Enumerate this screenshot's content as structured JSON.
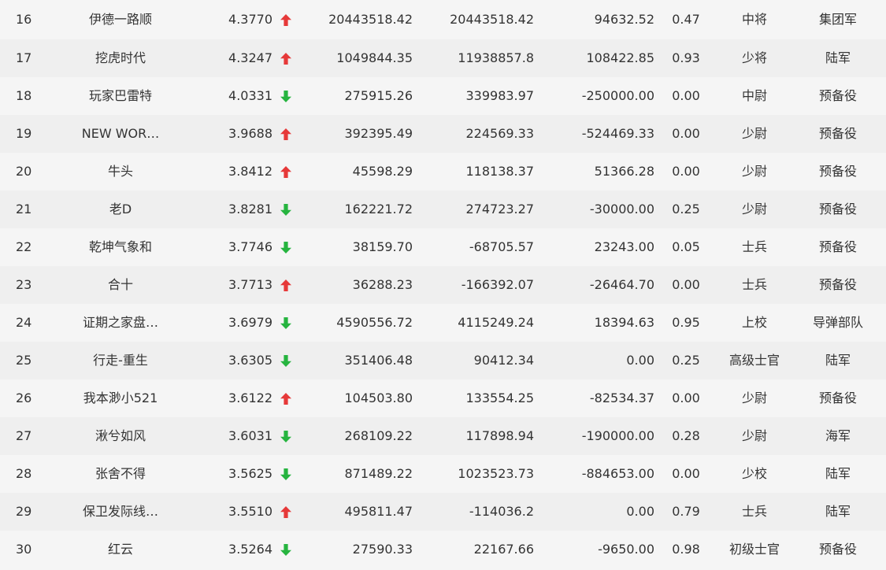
{
  "rows": [
    {
      "rank": "16",
      "name": "伊德一路顺",
      "score": "4.3770",
      "trend": "up",
      "value1": "20443518.42",
      "value2": "20443518.42",
      "value3": "94632.52",
      "ratio": "0.47",
      "military_rank": "中将",
      "branch": "集团军"
    },
    {
      "rank": "17",
      "name": "挖虎时代",
      "score": "4.3247",
      "trend": "up",
      "value1": "1049844.35",
      "value2": "11938857.8",
      "value3": "108422.85",
      "ratio": "0.93",
      "military_rank": "少将",
      "branch": "陆军"
    },
    {
      "rank": "18",
      "name": "玩家巴雷特",
      "score": "4.0331",
      "trend": "down",
      "value1": "275915.26",
      "value2": "339983.97",
      "value3": "-250000.00",
      "ratio": "0.00",
      "military_rank": "中尉",
      "branch": "预备役"
    },
    {
      "rank": "19",
      "name": "NEW WOR…",
      "score": "3.9688",
      "trend": "up",
      "value1": "392395.49",
      "value2": "224569.33",
      "value3": "-524469.33",
      "ratio": "0.00",
      "military_rank": "少尉",
      "branch": "预备役"
    },
    {
      "rank": "20",
      "name": "牛头",
      "score": "3.8412",
      "trend": "up",
      "value1": "45598.29",
      "value2": "118138.37",
      "value3": "51366.28",
      "ratio": "0.00",
      "military_rank": "少尉",
      "branch": "预备役"
    },
    {
      "rank": "21",
      "name": "老D",
      "score": "3.8281",
      "trend": "down",
      "value1": "162221.72",
      "value2": "274723.27",
      "value3": "-30000.00",
      "ratio": "0.25",
      "military_rank": "少尉",
      "branch": "预备役"
    },
    {
      "rank": "22",
      "name": "乾坤气象和",
      "score": "3.7746",
      "trend": "down",
      "value1": "38159.70",
      "value2": "-68705.57",
      "value3": "23243.00",
      "ratio": "0.05",
      "military_rank": "士兵",
      "branch": "预备役"
    },
    {
      "rank": "23",
      "name": "合十",
      "score": "3.7713",
      "trend": "up",
      "value1": "36288.23",
      "value2": "-166392.07",
      "value3": "-26464.70",
      "ratio": "0.00",
      "military_rank": "士兵",
      "branch": "预备役"
    },
    {
      "rank": "24",
      "name": "证期之家盘…",
      "score": "3.6979",
      "trend": "down",
      "value1": "4590556.72",
      "value2": "4115249.24",
      "value3": "18394.63",
      "ratio": "0.95",
      "military_rank": "上校",
      "branch": "导弹部队"
    },
    {
      "rank": "25",
      "name": "行走-重生",
      "score": "3.6305",
      "trend": "down",
      "value1": "351406.48",
      "value2": "90412.34",
      "value3": "0.00",
      "ratio": "0.25",
      "military_rank": "高级士官",
      "branch": "陆军"
    },
    {
      "rank": "26",
      "name": "我本渺小521",
      "score": "3.6122",
      "trend": "up",
      "value1": "104503.80",
      "value2": "133554.25",
      "value3": "-82534.37",
      "ratio": "0.00",
      "military_rank": "少尉",
      "branch": "预备役"
    },
    {
      "rank": "27",
      "name": "湫兮如风",
      "score": "3.6031",
      "trend": "down",
      "value1": "268109.22",
      "value2": "117898.94",
      "value3": "-190000.00",
      "ratio": "0.28",
      "military_rank": "少尉",
      "branch": "海军"
    },
    {
      "rank": "28",
      "name": "张舍不得",
      "score": "3.5625",
      "trend": "down",
      "value1": "871489.22",
      "value2": "1023523.73",
      "value3": "-884653.00",
      "ratio": "0.00",
      "military_rank": "少校",
      "branch": "陆军"
    },
    {
      "rank": "29",
      "name": "保卫发际线…",
      "score": "3.5510",
      "trend": "up",
      "value1": "495811.47",
      "value2": "-114036.2",
      "value3": "0.00",
      "ratio": "0.79",
      "military_rank": "士兵",
      "branch": "陆军"
    },
    {
      "rank": "30",
      "name": "红云",
      "score": "3.5264",
      "trend": "down",
      "value1": "27590.33",
      "value2": "22167.66",
      "value3": "-9650.00",
      "ratio": "0.98",
      "military_rank": "初级士官",
      "branch": "预备役"
    }
  ],
  "icons": {
    "up": "arrow-up-icon",
    "down": "arrow-down-icon"
  },
  "colors": {
    "up": "#e63939",
    "down": "#26b43f",
    "text": "#333333",
    "background": "#f5f5f5"
  }
}
